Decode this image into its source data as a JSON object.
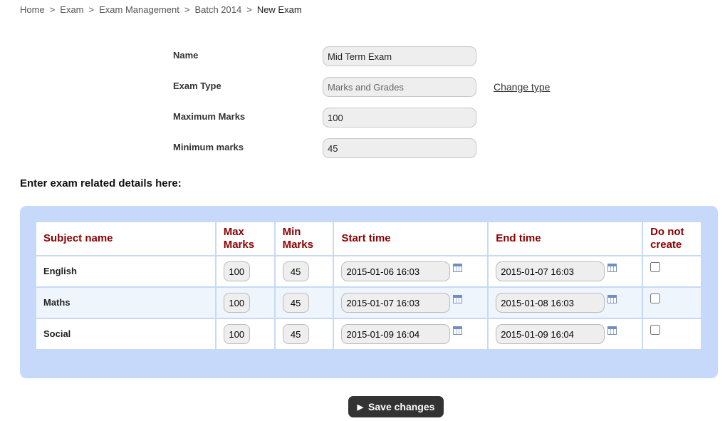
{
  "breadcrumb": {
    "items": [
      "Home",
      "Exam",
      "Exam Management",
      "Batch 2014"
    ],
    "separator": ">",
    "current": "New Exam"
  },
  "form": {
    "name_label": "Name",
    "name_value": "Mid Term Exam",
    "exam_type_label": "Exam Type",
    "exam_type_value": "Marks and Grades",
    "change_type_link": "Change type",
    "max_marks_label": "Maximum Marks",
    "max_marks_value": "100",
    "min_marks_label": "Minimum marks",
    "min_marks_value": "45"
  },
  "section_title": "Enter exam related details here:",
  "table": {
    "headers": {
      "subject": "Subject name",
      "max": [
        "Max",
        "Marks"
      ],
      "min": [
        "Min",
        "Marks"
      ],
      "start": "Start time",
      "end": "End time",
      "dnc": [
        "Do not",
        "create"
      ]
    },
    "rows": [
      {
        "subject": "English",
        "max": "100",
        "min": "45",
        "start": "2015-01-06 16:03",
        "end": "2015-01-07 16:03",
        "do_not_create": false
      },
      {
        "subject": "Maths",
        "max": "100",
        "min": "45",
        "start": "2015-01-07 16:03",
        "end": "2015-01-08 16:03",
        "do_not_create": false
      },
      {
        "subject": "Social",
        "max": "100",
        "min": "45",
        "start": "2015-01-09 16:04",
        "end": "2015-01-09 16:04",
        "do_not_create": false
      }
    ]
  },
  "save_button": {
    "icon": "play-icon",
    "label": "Save changes"
  },
  "colors": {
    "header_text": "#8b0000",
    "panel_bg": "#c7d9fb",
    "button_bg": "#333333"
  }
}
